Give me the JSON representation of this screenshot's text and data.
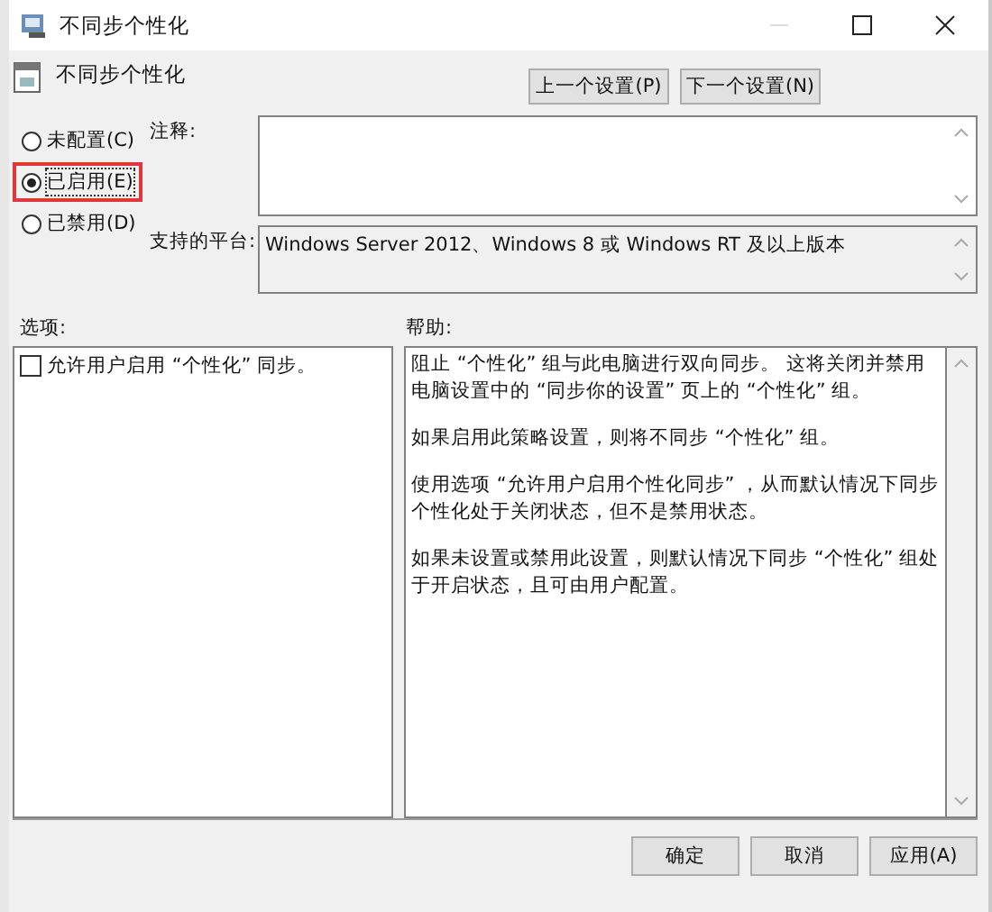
{
  "window": {
    "title": "不同步个性化"
  },
  "header": {
    "title": "不同步个性化",
    "buttons": [
      "上一个设置(P)",
      "下一个设置(N)"
    ]
  },
  "radios": [
    {
      "label": "未配置(C)",
      "selected": false
    },
    {
      "label": "已启用(E)",
      "selected": true
    },
    {
      "label": "已禁用(D)",
      "selected": false
    }
  ],
  "comment": {
    "label": "注释:"
  },
  "platform": {
    "label": "支持的平台:",
    "value": "Windows Server 2012、Windows 8 或 Windows RT 及以上版本"
  },
  "options": {
    "label": "选项:",
    "items": [
      {
        "label": "允许用户启用 “个性化” 同步。",
        "checked": false
      }
    ]
  },
  "help": {
    "label": "帮助:",
    "paragraphs": [
      "阻止 “个性化” 组与此电脑进行双向同步。 这将关闭并禁用电脑设置中的 “同步你的设置” 页上的 “个性化” 组。",
      "如果启用此策略设置，则将不同步 “个性化” 组。",
      "使用选项 “允许用户启用个性化同步” ，从而默认情况下同步个性化处于关闭状态，但不是禁用状态。",
      "如果未设置或禁用此设置，则默认情况下同步 “个性化” 组处于开启状态，且可由用户配置。"
    ]
  },
  "footer": {
    "buttons": [
      "确定",
      "取消",
      "应用(A)"
    ]
  }
}
